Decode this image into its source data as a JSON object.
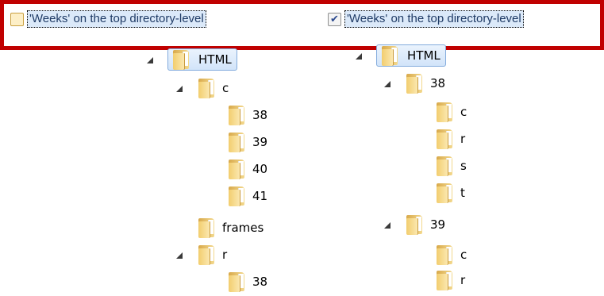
{
  "options": {
    "left": {
      "label": "'Weeks' on the top directory-level",
      "checked": false
    },
    "right": {
      "label": "'Weeks' on the top directory-level",
      "checked": true,
      "check_glyph": "✔"
    }
  },
  "left_tree": {
    "root": "HTML",
    "level1": [
      {
        "label": "c",
        "expanded": true,
        "children": [
          "38",
          "39",
          "40",
          "41"
        ]
      },
      {
        "label": "frames",
        "expanded": false
      },
      {
        "label": "r",
        "expanded": true,
        "children": [
          "38"
        ]
      }
    ]
  },
  "right_tree": {
    "root": "HTML",
    "level1": [
      {
        "label": "38",
        "expanded": true,
        "children": [
          "c",
          "r",
          "s",
          "t"
        ]
      },
      {
        "label": "39",
        "expanded": true,
        "children": [
          "c",
          "r"
        ]
      }
    ]
  },
  "colors": {
    "banner": "#c00000",
    "selection": "#d2e4f9",
    "label_highlight": "#dbe9f9"
  }
}
